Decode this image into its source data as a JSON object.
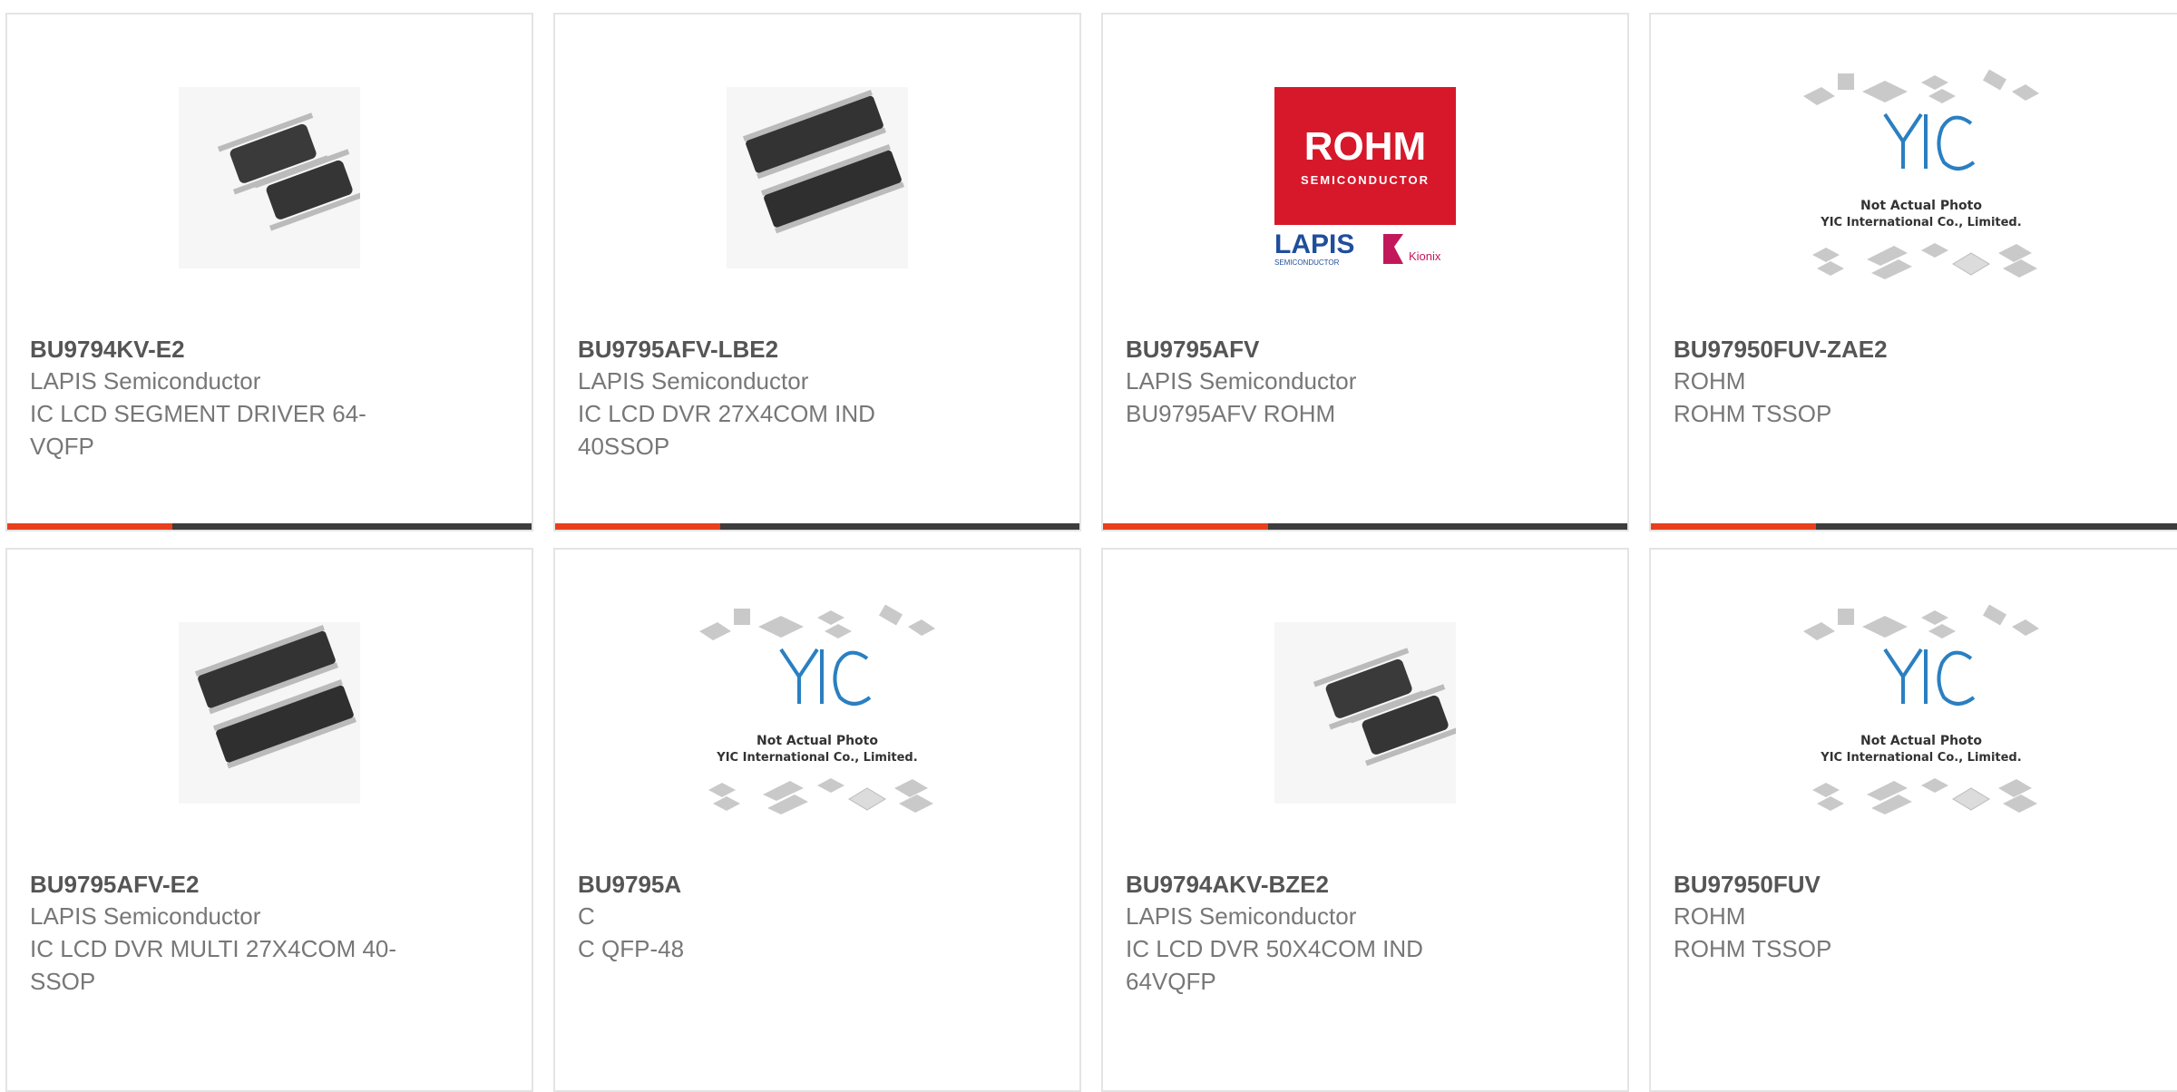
{
  "products": [
    {
      "part": "BU9794KV-E2",
      "manufacturer": "LAPIS Semiconductor",
      "description": "IC LCD SEGMENT DRIVER 64-VQFP",
      "image": "qfp-chips"
    },
    {
      "part": "BU9795AFV-LBE2",
      "manufacturer": "LAPIS Semiconductor",
      "description": "IC LCD DVR 27X4COM IND 40SSOP",
      "image": "ssop-chips"
    },
    {
      "part": "BU9795AFV",
      "manufacturer": "LAPIS Semiconductor",
      "description": "BU9795AFV ROHM",
      "image": "rohm-logo"
    },
    {
      "part": "BU97950FUV-ZAE2",
      "manufacturer": "ROHM",
      "description": "ROHM TSSOP",
      "image": "yic-placeholder"
    },
    {
      "part": "BU9795AFV-E2",
      "manufacturer": "LAPIS Semiconductor",
      "description": "IC LCD DVR MULTI 27X4COM 40-SSOP",
      "image": "ssop-chips"
    },
    {
      "part": "BU9795A",
      "manufacturer": "C",
      "description": "C QFP-48",
      "image": "yic-placeholder"
    },
    {
      "part": "BU9794AKV-BZE2",
      "manufacturer": "LAPIS Semiconductor",
      "description": "IC LCD DVR 50X4COM IND 64VQFP",
      "image": "qfp-chips"
    },
    {
      "part": "BU97950FUV",
      "manufacturer": "ROHM",
      "description": "ROHM TSSOP",
      "image": "yic-placeholder"
    }
  ],
  "logo_text": {
    "rohm": "ROHM",
    "semiconductor": "SEMICONDUCTOR",
    "lapis": "LAPIS",
    "lapis_sub": "SEMICONDUCTOR",
    "kionix": "Kionix"
  },
  "placeholder_text": {
    "line1": "Not Actual Photo",
    "line2": "YIC International Co., Limited."
  },
  "colors": {
    "accent": "#e8401c",
    "bar": "#3d3d3d",
    "rohm_red": "#d7182a",
    "lapis_blue": "#1f4e9c",
    "yic_blue": "#2a7fc1"
  }
}
